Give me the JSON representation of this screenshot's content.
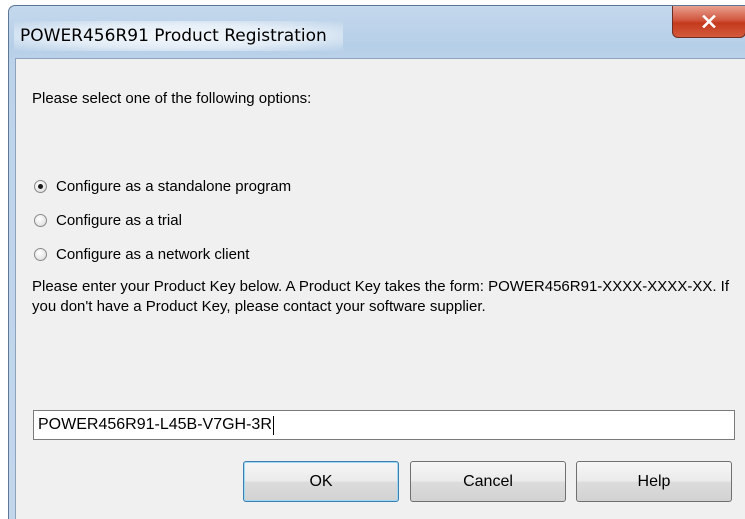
{
  "window": {
    "title": "POWER456R91 Product Registration",
    "close_icon": "close-icon",
    "close_color": "#c43a1d"
  },
  "dialog": {
    "prompt": "Please select one of the following options:",
    "options": [
      {
        "label": "Configure as a standalone program",
        "checked": true
      },
      {
        "label": "Configure as a trial",
        "checked": false
      },
      {
        "label": "Configure as a network client",
        "checked": false
      }
    ],
    "info": "Please enter your Product Key below. A Product Key takes the form: POWER456R91-XXXX-XXXX-XX. If you don't have a Product Key, please contact your software supplier.",
    "product_key": {
      "value": "POWER456R91-L45B-V7GH-3R",
      "placeholder": ""
    }
  },
  "buttons": {
    "ok": "OK",
    "cancel": "Cancel",
    "help": "Help"
  }
}
